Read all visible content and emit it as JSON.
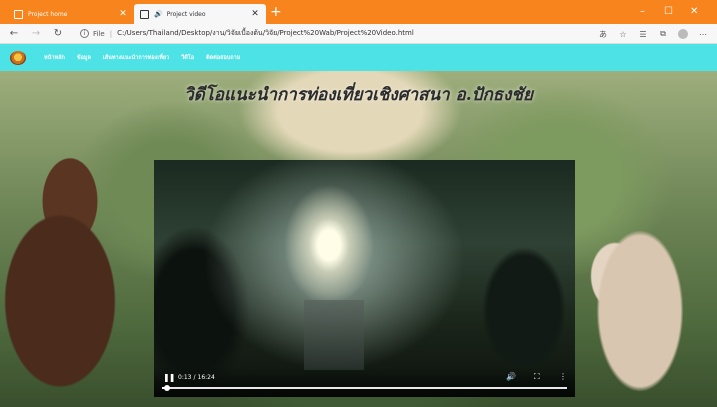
{
  "browser": {
    "tabs": [
      {
        "label": "Project home",
        "active": false
      },
      {
        "label": "Project video",
        "active": true,
        "audio_icon": "speaker-icon"
      }
    ],
    "new_tab_symbol": "+",
    "window_controls": {
      "minimize": "–",
      "maximize": "☐",
      "close": "✕"
    },
    "address": {
      "scheme": "File",
      "url": "C:/Users/Thailand/Desktop/งาน/วิจัยเบื้องต้น/วิจัย/Project%20Wab/Project%20Video.html"
    },
    "colors": {
      "titlebar": "#f7841c"
    }
  },
  "site": {
    "nav": {
      "items": [
        "หน้าหลัก",
        "ข้อมูล",
        "เส้นทางแนะนำการท่องเที่ยว",
        "วีดีโอ",
        "ติดต่อสอบถาม"
      ],
      "color": "#4ce2e6"
    },
    "hero_title": "วิดีโอแนะนำการท่องเที่ยวเชิงศาสนา อ.ปักธงชัย"
  },
  "video": {
    "current_time": "0:13",
    "duration": "16:24",
    "progress_fraction": 0.013
  }
}
